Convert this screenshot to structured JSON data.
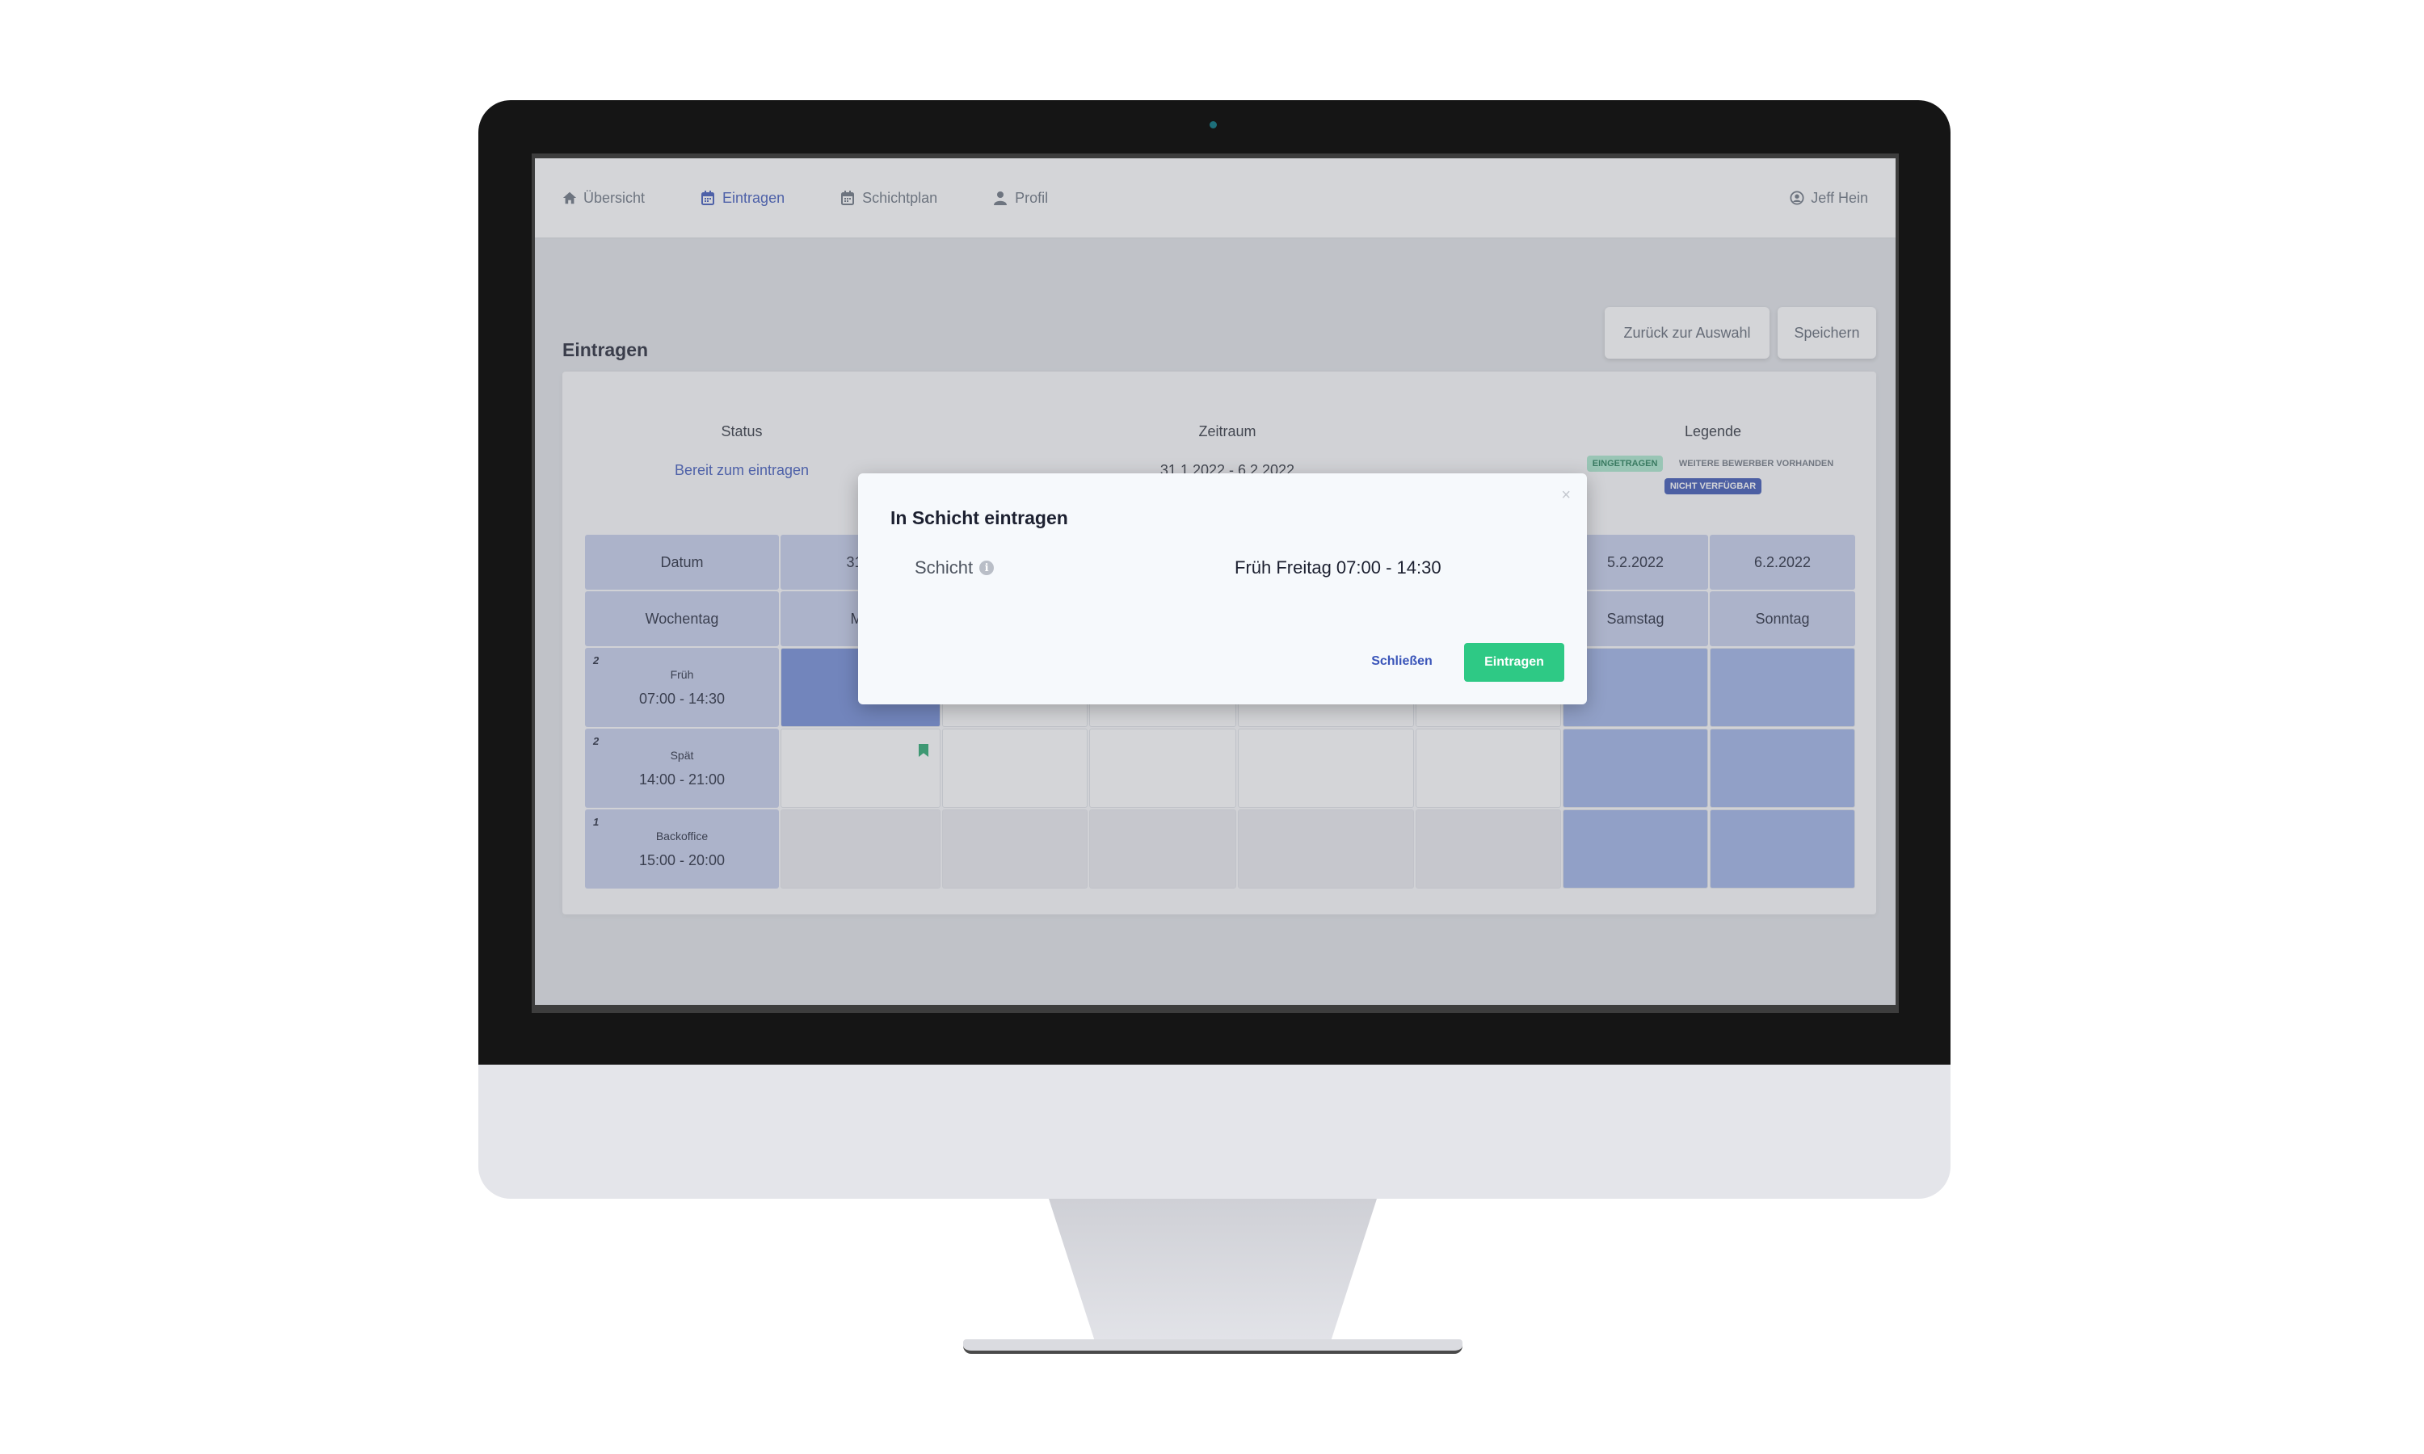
{
  "navbar": {
    "items": [
      {
        "label": "Übersicht",
        "icon": "home-icon"
      },
      {
        "label": "Eintragen",
        "icon": "calendar-icon"
      },
      {
        "label": "Schichtplan",
        "icon": "calendar-icon"
      },
      {
        "label": "Profil",
        "icon": "user-icon"
      }
    ],
    "active_index": 1,
    "user": {
      "label": "Jeff Hein",
      "icon": "user-circle-icon"
    }
  },
  "page": {
    "title": "Eintragen",
    "back_label": "Zurück zur Auswahl",
    "save_label": "Speichern"
  },
  "info": {
    "status_label": "Status",
    "status_value": "Bereit zum eintragen",
    "zeitraum_label": "Zeitraum",
    "zeitraum_value": "31.1.2022 - 6.2.2022",
    "legend_label": "Legende",
    "legend": {
      "eingetragen": "Eingetragen",
      "weitere": "Weitere Bewerber vorhanden",
      "nicht": "Nicht verfügbar"
    }
  },
  "grid": {
    "datum_label": "Datum",
    "wochentag_label": "Wochentag",
    "dates": [
      "31.1",
      "",
      "",
      "",
      "",
      "5.2.2022",
      "6.2.2022"
    ],
    "weekdays": [
      "Mo",
      "",
      "",
      "",
      "",
      "Samstag",
      "Sonntag"
    ],
    "shifts": [
      {
        "count": "2",
        "name": "Früh",
        "time": "07:00 - 14:30"
      },
      {
        "count": "2",
        "name": "Spät",
        "time": "14:00 - 21:00"
      },
      {
        "count": "1",
        "name": "Backoffice",
        "time": "15:00 - 20:00"
      }
    ]
  },
  "modal": {
    "title": "In Schicht eintragen",
    "close_glyph": "×",
    "field_label": "Schicht",
    "info_glyph": "i",
    "field_value": "Früh Freitag 07:00 - 14:30",
    "close_label": "Schließen",
    "submit_label": "Eintragen"
  },
  "colors": {
    "accent": "#3a55b9",
    "success": "#2ec985",
    "header_cell": "#c4cdeb",
    "blocked": "#9db1e6"
  }
}
